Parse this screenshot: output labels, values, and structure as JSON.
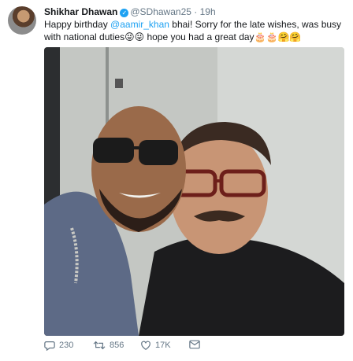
{
  "tweet": {
    "author_name": "Shikhar Dhawan",
    "handle": "@SDhawan25",
    "separator": "·",
    "time": "19h",
    "text_part1": "Happy birthday ",
    "mention": "@aamir_khan",
    "text_part2": " bhai! Sorry for the late wishes, was busy with national duties",
    "text_part3": " hope you had a great day",
    "emoji_1": "😜😜",
    "emoji_2": "🎂🎂🤗🤗"
  },
  "actions": {
    "replies": "230",
    "retweets": "856",
    "likes": "17K"
  },
  "icons": [
    "avatar",
    "verified-badge-icon",
    "reply-icon",
    "retweet-icon",
    "like-icon",
    "message-icon"
  ],
  "colors": {
    "accent": "#1da1f2",
    "muted": "#657786",
    "text": "#14171a"
  }
}
